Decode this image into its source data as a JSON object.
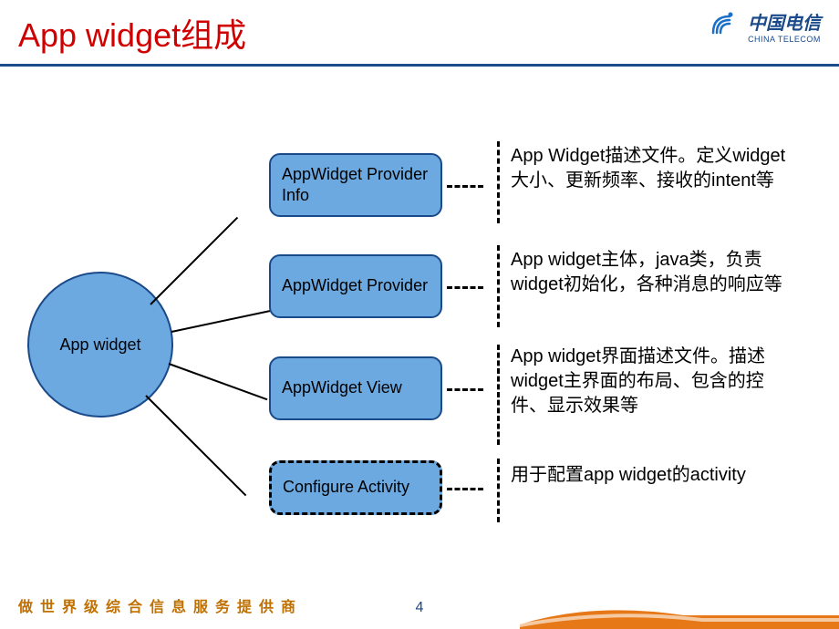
{
  "header": {
    "title": "App widget组成",
    "logo_cn": "中国电信",
    "logo_en": "CHINA TELECOM"
  },
  "diagram": {
    "center": "App widget",
    "components": [
      {
        "label": "AppWidget Provider Info",
        "description": "App Widget描述文件。定义widget大小、更新频率、接收的intent等"
      },
      {
        "label": "AppWidget Provider",
        "description": "App widget主体，java类，负责widget初始化，各种消息的响应等"
      },
      {
        "label": "AppWidget View",
        "description": "App widget界面描述文件。描述widget主界面的布局、包含的控件、显示效果等"
      },
      {
        "label": "Configure Activity",
        "description": "用于配置app widget的activity"
      }
    ]
  },
  "footer": {
    "tagline": "做世界级综合信息服务提供商",
    "page": "4"
  }
}
